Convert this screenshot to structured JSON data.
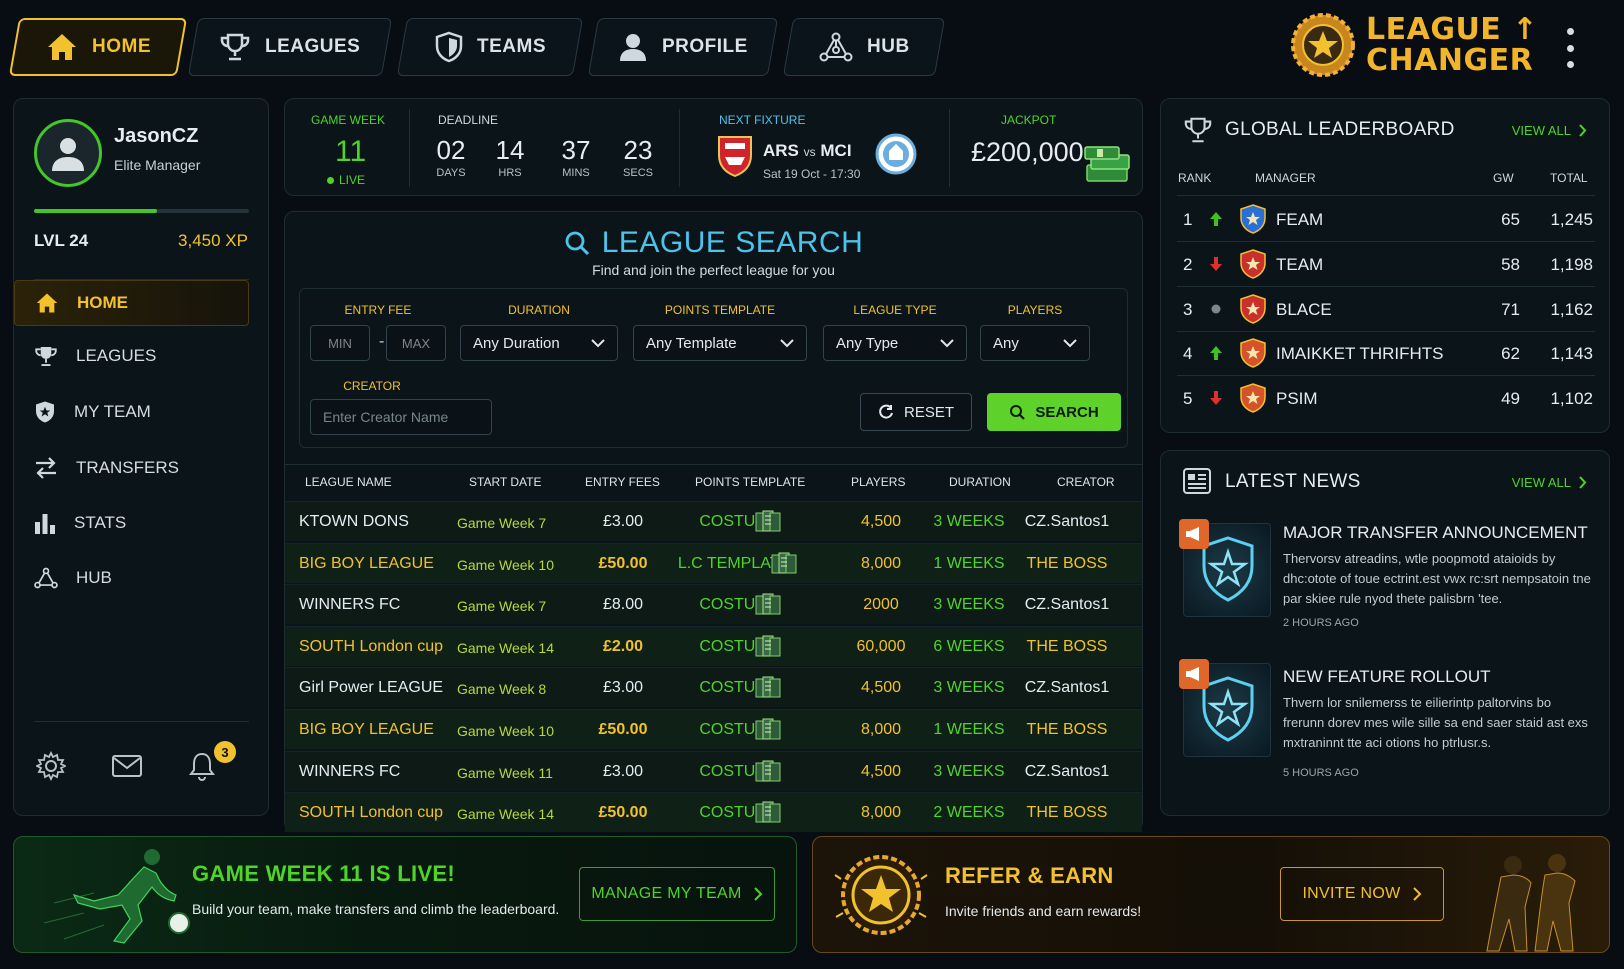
{
  "nav": {
    "tabs": [
      {
        "label": "HOME",
        "icon": "home-icon",
        "active": true
      },
      {
        "label": "LEAGUES",
        "icon": "trophy-icon"
      },
      {
        "label": "TEAMS",
        "icon": "shield-icon"
      },
      {
        "label": "PROFILE",
        "icon": "user-icon"
      },
      {
        "label": "HUB",
        "icon": "hub-icon"
      }
    ],
    "logo_line1": "LEAGUE",
    "logo_line2": "CHANGER"
  },
  "user": {
    "name": "JasonCZ",
    "role": "Elite Manager",
    "level": "LVL 24",
    "xp": "3,450 XP",
    "xp_progress": 0.57
  },
  "sidebar": {
    "items": [
      {
        "label": "HOME",
        "icon": "home-icon",
        "active": true
      },
      {
        "label": "LEAGUES",
        "icon": "trophy-icon"
      },
      {
        "label": "MY TEAM",
        "icon": "shield-icon"
      },
      {
        "label": "TRANSFERS",
        "icon": "transfer-icon"
      },
      {
        "label": "STATS",
        "icon": "bar-chart-icon"
      },
      {
        "label": "HUB",
        "icon": "hub-icon"
      }
    ],
    "notification_count": "3"
  },
  "info": {
    "game_week_label": "GAME WEEK",
    "game_week": "11",
    "live_label": "LIVE",
    "deadline_label": "DEADLINE",
    "countdown": [
      {
        "value": "02",
        "unit": "DAYS"
      },
      {
        "value": "14",
        "unit": "HRS"
      },
      {
        "value": "37",
        "unit": "MINS"
      },
      {
        "value": "23",
        "unit": "SECS"
      }
    ],
    "next_fixture_label": "NEXT FIXTURE",
    "home": "ARS",
    "vs": "vs",
    "away": "MCI",
    "fixture_date": "Sat 19 Oct - 17:30",
    "jackpot_label": "JACKPOT",
    "jackpot": "£200,000"
  },
  "search": {
    "title": "LEAGUE SEARCH",
    "subtitle": "Find and join the perfect league for you",
    "filters": {
      "entry_fee_label": "ENTRY FEE",
      "min_placeholder": "MIN",
      "max_placeholder": "MAX",
      "duration_label": "DURATION",
      "duration_value": "Any Duration",
      "points_label": "POINTS TEMPLATE",
      "points_value": "Any Template",
      "type_label": "LEAGUE TYPE",
      "type_value": "Any Type",
      "players_label": "PLAYERS",
      "players_value": "Any",
      "creator_label": "CREATOR",
      "creator_placeholder": "Enter Creator Name",
      "reset_label": "RESET",
      "search_label": "SEARCH"
    },
    "columns": [
      "LEAGUE NAME",
      "START DATE",
      "ENTRY FEES",
      "POINTS TEMPLATE",
      "PLAYERS",
      "DURATION",
      "CREATOR"
    ],
    "rows": [
      {
        "name": "KTOWN DONS",
        "start": "Game Week 7",
        "fee": "£3.00",
        "template": "COSTUM",
        "players": "4,500",
        "duration": "3 WEEKS",
        "creator": "CZ.Santos1",
        "highlight": false
      },
      {
        "name": "BIG BOY LEAGUE",
        "start": "Game Week 10",
        "fee": "£50.00",
        "template": "L.C TEMPLATE",
        "players": "8,000",
        "duration": "1 WEEKS",
        "creator": "THE BOSS",
        "highlight": true
      },
      {
        "name": "WINNERS FC",
        "start": "Game Week 7",
        "fee": "£8.00",
        "template": "COSTUM",
        "players": "2000",
        "duration": "3 WEEKS",
        "creator": "CZ.Santos1",
        "highlight": false
      },
      {
        "name": "SOUTH London cup",
        "start": "Game Week 14",
        "fee": "£2.00",
        "template": "COSTUM",
        "players": "60,000",
        "duration": "6 WEEKS",
        "creator": "THE BOSS",
        "highlight": true
      },
      {
        "name": "Girl Power LEAGUE",
        "start": "Game Week 8",
        "fee": "£3.00",
        "template": "COSTUM",
        "players": "4,500",
        "duration": "3 WEEKS",
        "creator": "CZ.Santos1",
        "highlight": false
      },
      {
        "name": "BIG BOY LEAGUE",
        "start": "Game Week 10",
        "fee": "£50.00",
        "template": "COSTUM",
        "players": "8,000",
        "duration": "1 WEEKS",
        "creator": "THE BOSS",
        "highlight": true
      },
      {
        "name": "WINNERS FC",
        "start": "Game Week 11",
        "fee": "£3.00",
        "template": "COSTUM",
        "players": "4,500",
        "duration": "3 WEEKS",
        "creator": "CZ.Santos1",
        "highlight": false
      },
      {
        "name": "SOUTH London cup",
        "start": "Game Week 14",
        "fee": "£50.00",
        "template": "COSTUM",
        "players": "8,000",
        "duration": "2 WEEKS",
        "creator": "THE BOSS",
        "highlight": true
      }
    ]
  },
  "leaderboard": {
    "title": "GLOBAL LEADERBOARD",
    "view_all": "VIEW ALL",
    "columns": [
      "RANK",
      "MANAGER",
      "GW",
      "TOTAL"
    ],
    "rows": [
      {
        "rank": "1",
        "trend": "up",
        "manager": "FEAM",
        "gw": "65",
        "total": "1,245",
        "badge_color": "#2a6fd6"
      },
      {
        "rank": "2",
        "trend": "down",
        "manager": "TEAM",
        "gw": "58",
        "total": "1,198",
        "badge_color": "#c9302c"
      },
      {
        "rank": "3",
        "trend": "same",
        "manager": "BLACE",
        "gw": "71",
        "total": "1,162",
        "badge_color": "#c9302c"
      },
      {
        "rank": "4",
        "trend": "up",
        "manager": "IMAIKKET THRIFHTS",
        "gw": "62",
        "total": "1,143",
        "badge_color": "#d6532a"
      },
      {
        "rank": "5",
        "trend": "down",
        "manager": "PSIM",
        "gw": "49",
        "total": "1,102",
        "badge_color": "#d6532a"
      }
    ]
  },
  "news": {
    "title": "LATEST NEWS",
    "view_all": "VIEW ALL",
    "items": [
      {
        "title": "MAJOR TRANSFER ANNOUNCEMENT",
        "body": "Thervorsv atreadins, wtle poopmotd ataioids by dhc:otote of toue ectrint.est vwx rc:srt nempsatoin tne par skiee rule nyod thete palisbrn 'tee.",
        "time": "2 HOURS AGO"
      },
      {
        "title": "NEW FEATURE ROLLOUT",
        "body": "Thvern lor snilemerss te eilierintp paltorvins bo frerunn dorev mes wile sille sa end saer staid ast exs mxtraninnt tte aci otions ho ptrlusr.s.",
        "time": "5 HOURS AGO"
      }
    ]
  },
  "banners": {
    "live_title": "GAME WEEK 11 IS LIVE!",
    "live_sub": "Build your team, make transfers and climb the leaderboard.",
    "live_button": "MANAGE MY TEAM",
    "refer_title": "REFER & EARN",
    "refer_sub": "Invite friends and earn rewards!",
    "refer_button": "INVITE NOW"
  },
  "colors": {
    "accent_gold": "#f2c12e",
    "accent_green": "#4fd42a",
    "accent_blue": "#4cc3ea",
    "up": "#3fc21f",
    "down": "#e0302c"
  }
}
